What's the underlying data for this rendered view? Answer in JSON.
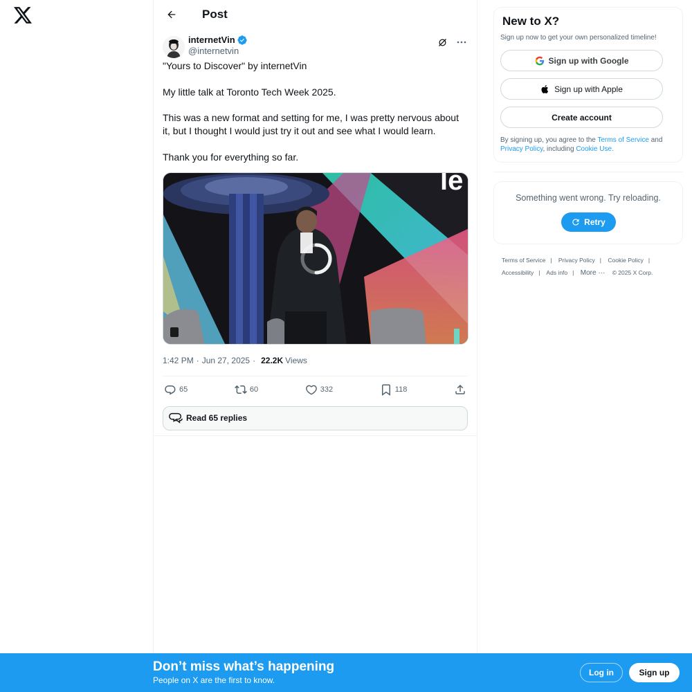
{
  "header": {
    "title": "Post"
  },
  "post": {
    "author_name": "internetVin",
    "author_handle": "@internetvin",
    "paragraphs": [
      "\"Yours to Discover\" by internetVin",
      "My little talk at Toronto Tech Week 2025.",
      "This was a new format and setting for me, I was pretty nervous about it, but I thought I would just try it out and see what I would learn.",
      "Thank you for everything so far."
    ],
    "media_overlay_text": "le",
    "time": "1:42 PM",
    "date": "Jun 27, 2025",
    "views_count": "22.2K",
    "views_label": "Views",
    "replies": "65",
    "reposts": "60",
    "likes": "332",
    "bookmarks": "118",
    "read_replies_label": "Read 65 replies"
  },
  "sidebar": {
    "title": "New to X?",
    "subtitle": "Sign up now to get your own personalized timeline!",
    "google_label": "Sign up with Google",
    "apple_label": "Sign up with Apple",
    "create_label": "Create account",
    "terms_prefix": "By signing up, you agree to the ",
    "terms_link": "Terms of Service",
    "terms_and": " and ",
    "privacy_link": "Privacy Policy",
    "terms_including": ", including ",
    "cookie_link": "Cookie Use",
    "terms_end": ".",
    "error_text": "Something went wrong. Try reloading.",
    "retry_label": "Retry",
    "footer": {
      "terms": "Terms of Service",
      "privacy": "Privacy Policy",
      "cookie": "Cookie Policy",
      "accessibility": "Accessibility",
      "ads": "Ads info",
      "more": "More",
      "copyright": "© 2025 X Corp."
    }
  },
  "banner": {
    "title": "Don’t miss what’s happening",
    "subtitle": "People on X are the first to know.",
    "login": "Log in",
    "signup": "Sign up"
  },
  "colors": {
    "accent": "#1d9bf0",
    "text": "#0f1419",
    "secondary": "#536471"
  }
}
